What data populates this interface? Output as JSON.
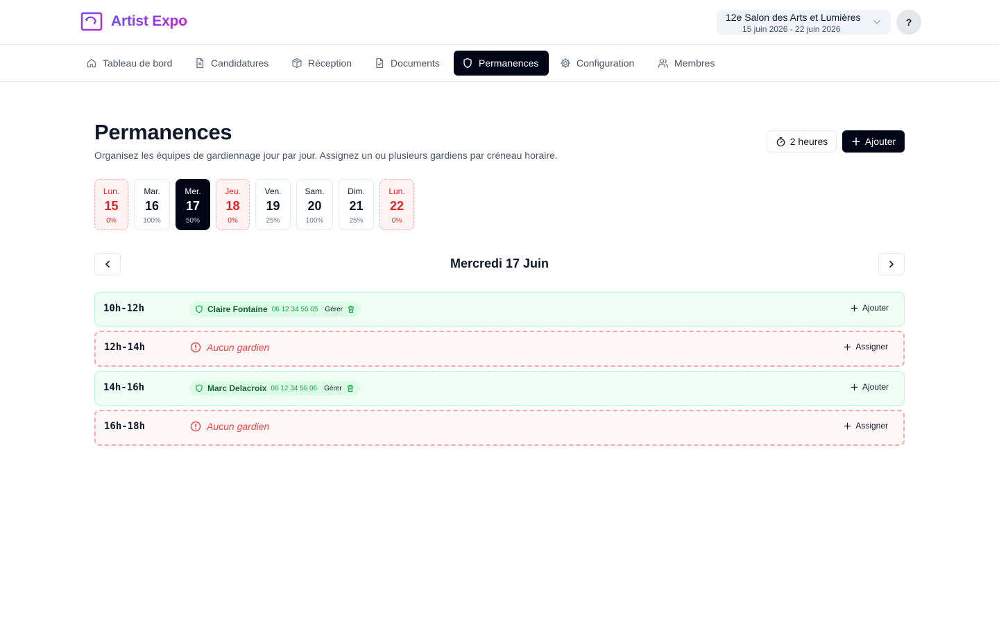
{
  "header": {
    "app_name": "Artist Expo",
    "event_name": "12e Salon des Arts et Lumières",
    "event_dates": "15 juin 2026 - 22 juin 2026",
    "help_label": "?"
  },
  "nav": {
    "items": [
      {
        "label": "Tableau de bord",
        "icon": "home-icon"
      },
      {
        "label": "Candidatures",
        "icon": "document-icon"
      },
      {
        "label": "Réception",
        "icon": "package-icon"
      },
      {
        "label": "Documents",
        "icon": "file-check-icon"
      },
      {
        "label": "Permanences",
        "icon": "shield-icon",
        "active": true
      },
      {
        "label": "Configuration",
        "icon": "gear-icon"
      },
      {
        "label": "Membres",
        "icon": "users-icon"
      }
    ]
  },
  "page": {
    "title": "Permanences",
    "subtitle": "Organisez les équipes de gardiennage jour par jour. Assignez un ou plusieurs gardiens par créneau horaire.",
    "duration_label": "2 heures",
    "add_label": "Ajouter"
  },
  "days": [
    {
      "name": "Lun.",
      "num": "15",
      "pct": "0%",
      "state": "empty"
    },
    {
      "name": "Mar.",
      "num": "16",
      "pct": "100%",
      "state": "normal"
    },
    {
      "name": "Mer.",
      "num": "17",
      "pct": "50%",
      "state": "selected"
    },
    {
      "name": "Jeu.",
      "num": "18",
      "pct": "0%",
      "state": "empty"
    },
    {
      "name": "Ven.",
      "num": "19",
      "pct": "25%",
      "state": "normal"
    },
    {
      "name": "Sam.",
      "num": "20",
      "pct": "100%",
      "state": "normal"
    },
    {
      "name": "Dim.",
      "num": "21",
      "pct": "25%",
      "state": "normal"
    },
    {
      "name": "Lun.",
      "num": "22",
      "pct": "0%",
      "state": "empty"
    }
  ],
  "day_view": {
    "heading": "Mercredi 17 Juin"
  },
  "slots": [
    {
      "time": "10h-12h",
      "state": "filled",
      "guard": "Claire Fontaine",
      "phone": "06 12 34 56 05",
      "manage": "Gérer",
      "action": "Ajouter"
    },
    {
      "time": "12h-14h",
      "state": "empty",
      "empty_text": "Aucun gardien",
      "action": "Assigner"
    },
    {
      "time": "14h-16h",
      "state": "filled",
      "guard": "Marc Delacroix",
      "phone": "06 12 34 56 06",
      "manage": "Gérer",
      "action": "Ajouter"
    },
    {
      "time": "16h-18h",
      "state": "empty",
      "empty_text": "Aucun gardien",
      "action": "Assigner"
    }
  ],
  "colors": {
    "accent_dark": "#020617",
    "success_bg": "#f0fdf4",
    "danger": "#dc2626",
    "brand_start": "#6d4df2",
    "brand_end": "#c026d3"
  }
}
